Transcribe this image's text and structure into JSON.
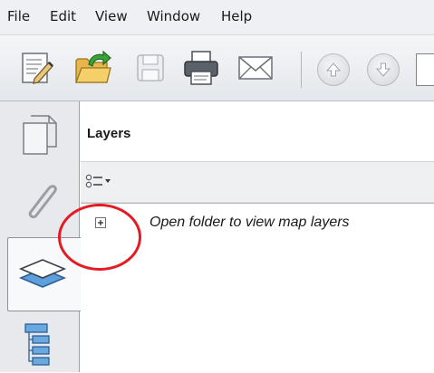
{
  "menu": {
    "items": [
      "File",
      "Edit",
      "View",
      "Window",
      "Help"
    ]
  },
  "toolbar": {
    "buttons": [
      "edit-document-icon",
      "open-folder-icon",
      "save-icon",
      "print-icon",
      "email-icon",
      "previous-page-icon",
      "next-page-icon"
    ]
  },
  "left_nav": {
    "tabs": [
      "pages-icon",
      "attachments-icon",
      "layers-icon",
      "model-tree-icon"
    ],
    "active": "layers-icon"
  },
  "panel": {
    "title": "Layers",
    "tree": {
      "items": [
        {
          "label": "Open folder to view map layers",
          "expanded": false
        }
      ]
    }
  },
  "annotation": {
    "color": "#e41b23",
    "shape": "ellipse"
  }
}
